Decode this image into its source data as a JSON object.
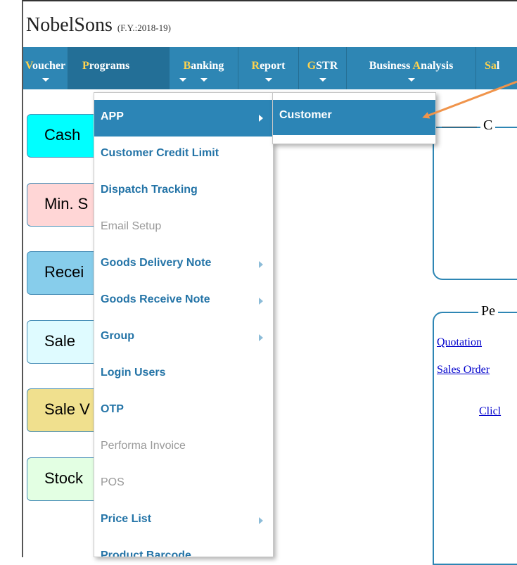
{
  "app": {
    "name": "NobelSons",
    "fy": "(F.Y.:2018-19)"
  },
  "nav": [
    {
      "hotkey": "V",
      "rest": "oucher"
    },
    {
      "hotkey": "P",
      "rest": "rograms"
    },
    {
      "hotkey": "B",
      "rest": "anking"
    },
    {
      "hotkey": "R",
      "rest": "eport"
    },
    {
      "hotkey": "G",
      "rest": "STR"
    },
    {
      "pre": "Business ",
      "hotkey": "A",
      "rest": "nalysis"
    },
    {
      "hotkey": "Sa",
      "rest": "l"
    }
  ],
  "tiles": [
    {
      "label": "Cash",
      "color": "#00ffff"
    },
    {
      "label": "Min. S",
      "color": "#ffd6d6"
    },
    {
      "label": "Recei",
      "color": "#87cdeb"
    },
    {
      "label": "Sale",
      "color": "#dffbff"
    },
    {
      "label": "Sale V",
      "color": "#f0e08e"
    },
    {
      "label": "Stock",
      "color": "#e3ffe3"
    }
  ],
  "panels": {
    "top_title": "C",
    "bottom_title": "Pe",
    "links": [
      "Quotation",
      "Sales Order",
      "Clicl"
    ]
  },
  "menu": [
    {
      "label": "APP",
      "has_sub": true,
      "state": "highlighted"
    },
    {
      "label": "Customer Credit Limit",
      "has_sub": false,
      "state": "enabled"
    },
    {
      "label": "Dispatch Tracking",
      "has_sub": false,
      "state": "enabled"
    },
    {
      "label": "Email Setup",
      "has_sub": false,
      "state": "disabled"
    },
    {
      "label": "Goods Delivery Note",
      "has_sub": true,
      "state": "enabled"
    },
    {
      "label": "Goods Receive Note",
      "has_sub": true,
      "state": "enabled"
    },
    {
      "label": "Group",
      "has_sub": true,
      "state": "enabled"
    },
    {
      "label": "Login Users",
      "has_sub": false,
      "state": "enabled"
    },
    {
      "label": "OTP",
      "has_sub": false,
      "state": "enabled"
    },
    {
      "label": "Performa Invoice",
      "has_sub": false,
      "state": "disabled"
    },
    {
      "label": "POS",
      "has_sub": false,
      "state": "disabled"
    },
    {
      "label": "Price List",
      "has_sub": true,
      "state": "enabled"
    },
    {
      "label": "Product Barcode",
      "has_sub": false,
      "state": "enabled"
    }
  ],
  "submenu": [
    {
      "label": "Customer"
    }
  ],
  "colors": {
    "accent": "#2e86b4",
    "annotation_arrow": "#f0944b",
    "disabled": "#9a9a9a"
  }
}
